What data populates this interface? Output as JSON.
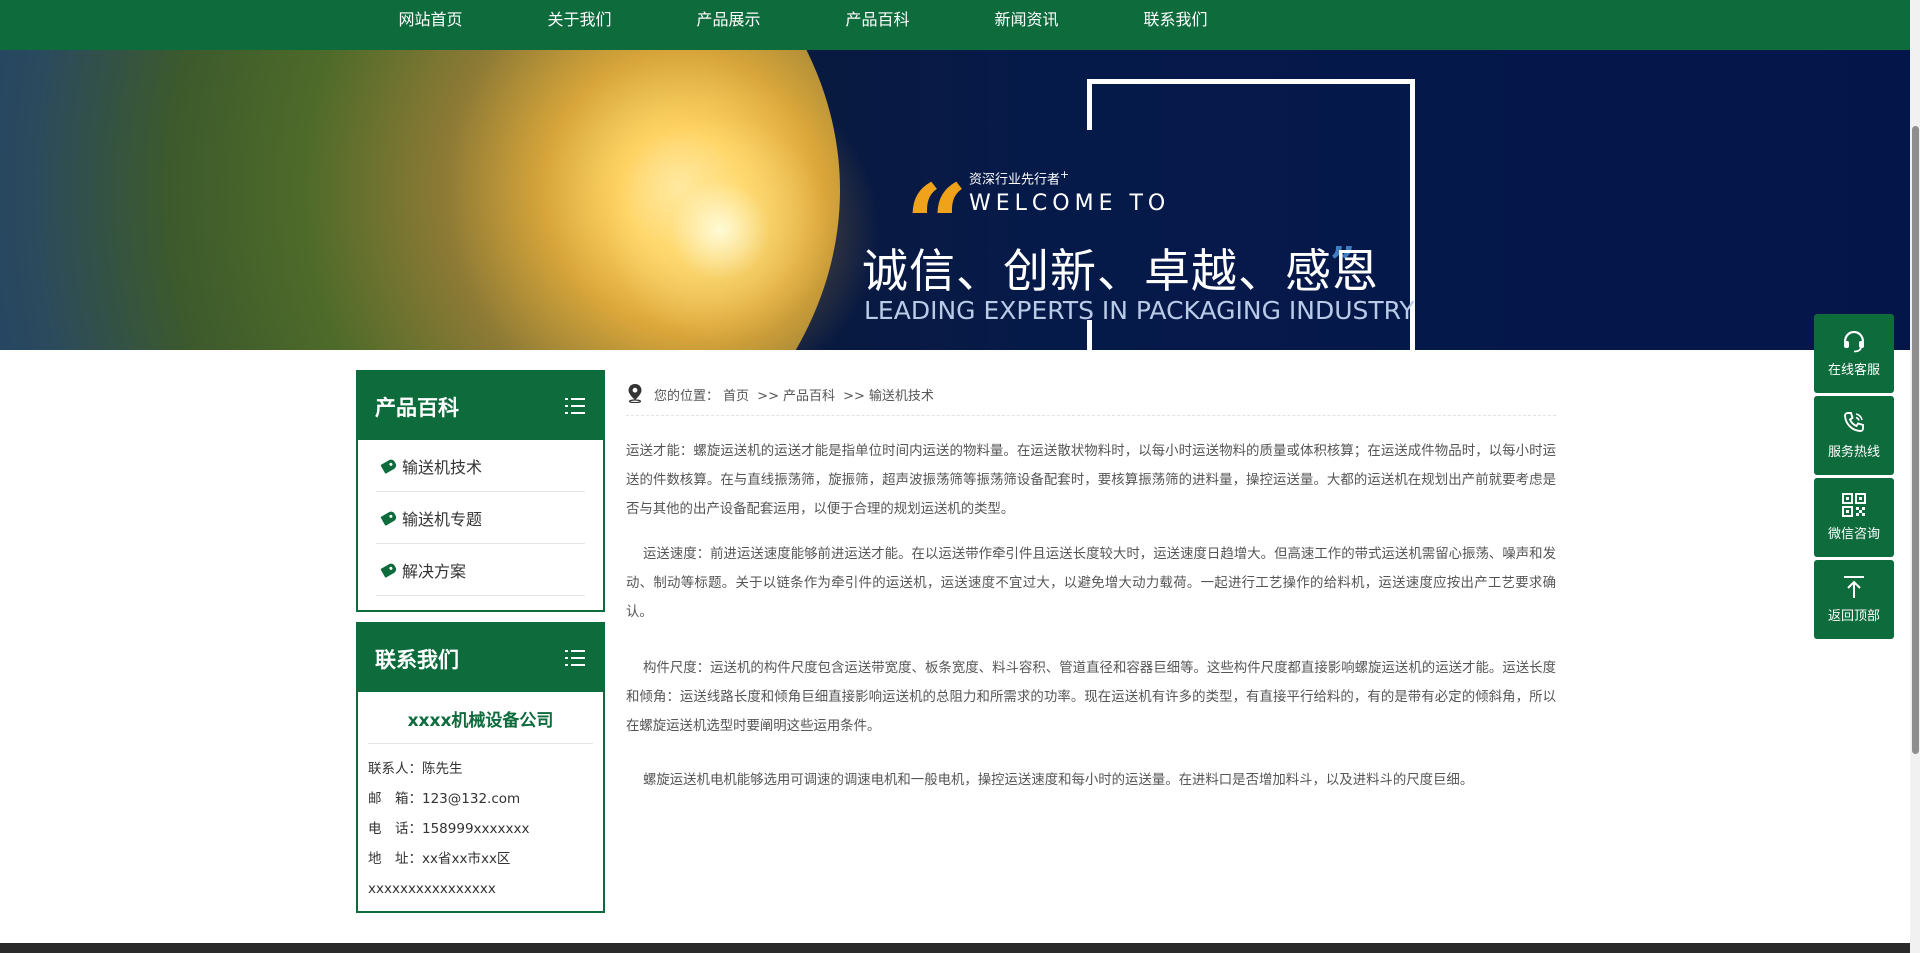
{
  "nav": {
    "items": [
      "网站首页",
      "关于我们",
      "产品展示",
      "产品百科",
      "新闻资讯",
      "联系我们"
    ]
  },
  "banner": {
    "tagline": "资深行业先行者",
    "tagline_mark": "+",
    "welcome": "WELCOME TO",
    "motto": "诚信、创新、卓越、感恩",
    "subtitle": "LEADING EXPERTS IN PACKAGING INDUSTRY",
    "quote_open": "“",
    "quote_close": "”"
  },
  "sidebar": {
    "category_box": {
      "title": "产品百科",
      "items": [
        "输送机技术",
        "输送机专题",
        "解决方案"
      ]
    },
    "contact_box": {
      "title": "联系我们",
      "company": "xxxx机械设备公司",
      "lines": [
        "联系人：陈先生",
        "邮　箱：123@132.com",
        "电　话：158999xxxxxxx",
        "地　址：xx省xx市xx区",
        "xxxxxxxxxxxxxxxx"
      ]
    }
  },
  "breadcrumb": {
    "prefix": "您的位置：",
    "home": "首页",
    "sep": ">>",
    "level1": "产品百科",
    "level2": "输送机技术"
  },
  "article": {
    "paragraphs": [
      "运送才能：螺旋运送机的运送才能是指单位时间内运送的物料量。在运送散状物料时，以每小时运送物料的质量或体积核算；在运送成件物品时，以每小时运送的件数核算。在与直线振荡筛，旋振筛，超声波振荡筛等振荡筛设备配套时，要核算振荡筛的进料量，操控运送量。大都的运送机在规划出产前就要考虑是否与其他的出产设备配套运用，以便于合理的规划运送机的类型。",
      "运送速度：前进运送速度能够前进运送才能。在以运送带作牵引件且运送长度较大时，运送速度日趋增大。但高速工作的带式运送机需留心振荡、噪声和发动、制动等标题。关于以链条作为牵引件的运送机，运送速度不宜过大，以避免增大动力载荷。一起进行工艺操作的给料机，运送速度应按出产工艺要求确认。",
      "构件尺度：运送机的构件尺度包含运送带宽度、板条宽度、料斗容积、管道直径和容器巨细等。这些构件尺度都直接影响螺旋运送机的运送才能。运送长度和倾角：运送线路长度和倾角巨细直接影响运送机的总阻力和所需求的功率。现在运送机有许多的类型，有直接平行给料的，有的是带有必定的倾斜角，所以在螺旋运送机选型时要阐明这些运用条件。",
      "螺旋运送机电机能够选用可调速的调速电机和一般电机，操控运送速度和每小时的运送量。在进料口是否增加料斗，以及进料斗的尺度巨细。"
    ]
  },
  "float_bar": {
    "items": [
      {
        "label": "在线客服",
        "icon": "headset-icon"
      },
      {
        "label": "服务热线",
        "icon": "phone-icon"
      },
      {
        "label": "微信咨询",
        "icon": "qrcode-icon"
      },
      {
        "label": "返回顶部",
        "icon": "arrow-up-icon"
      }
    ]
  },
  "colors": {
    "brand_green": "#0d6b3c",
    "banner_navy": "#061a4a",
    "quote_orange": "#f0a21a"
  }
}
